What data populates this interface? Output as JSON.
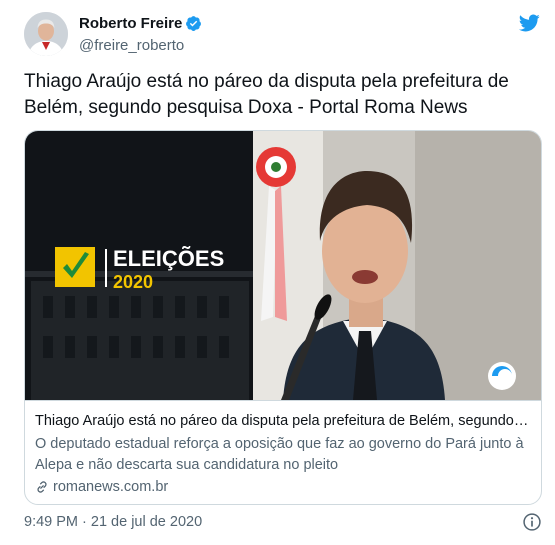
{
  "author": {
    "name": "Roberto Freire",
    "handle": "@freire_roberto"
  },
  "tweet": {
    "text": "Thiago Araújo está no páreo da disputa pela prefeitura de Belém, segundo pesquisa Doxa - Portal Roma News",
    "timestamp": "9:49 PM · 21 de jul de 2020"
  },
  "card": {
    "banner_word": "ELEIÇÕES",
    "banner_year": "2020",
    "title": "Thiago Araújo está no páreo da disputa pela prefeitura de Belém, segundo pesquisa Doxa - Portal Roma News",
    "description": "O deputado estadual reforça a oposição que faz ao governo do Pará junto à Alepa e não descarta sua candidatura no pleito",
    "domain": "romanews.com.br"
  },
  "icons": {
    "verified": "verified-badge-icon",
    "brand": "twitter-bird-icon",
    "link": "link-icon",
    "info": "info-icon"
  },
  "colors": {
    "brand_blue": "#1d9bf0",
    "secondary_text": "#536471",
    "border": "#cfd9de"
  }
}
